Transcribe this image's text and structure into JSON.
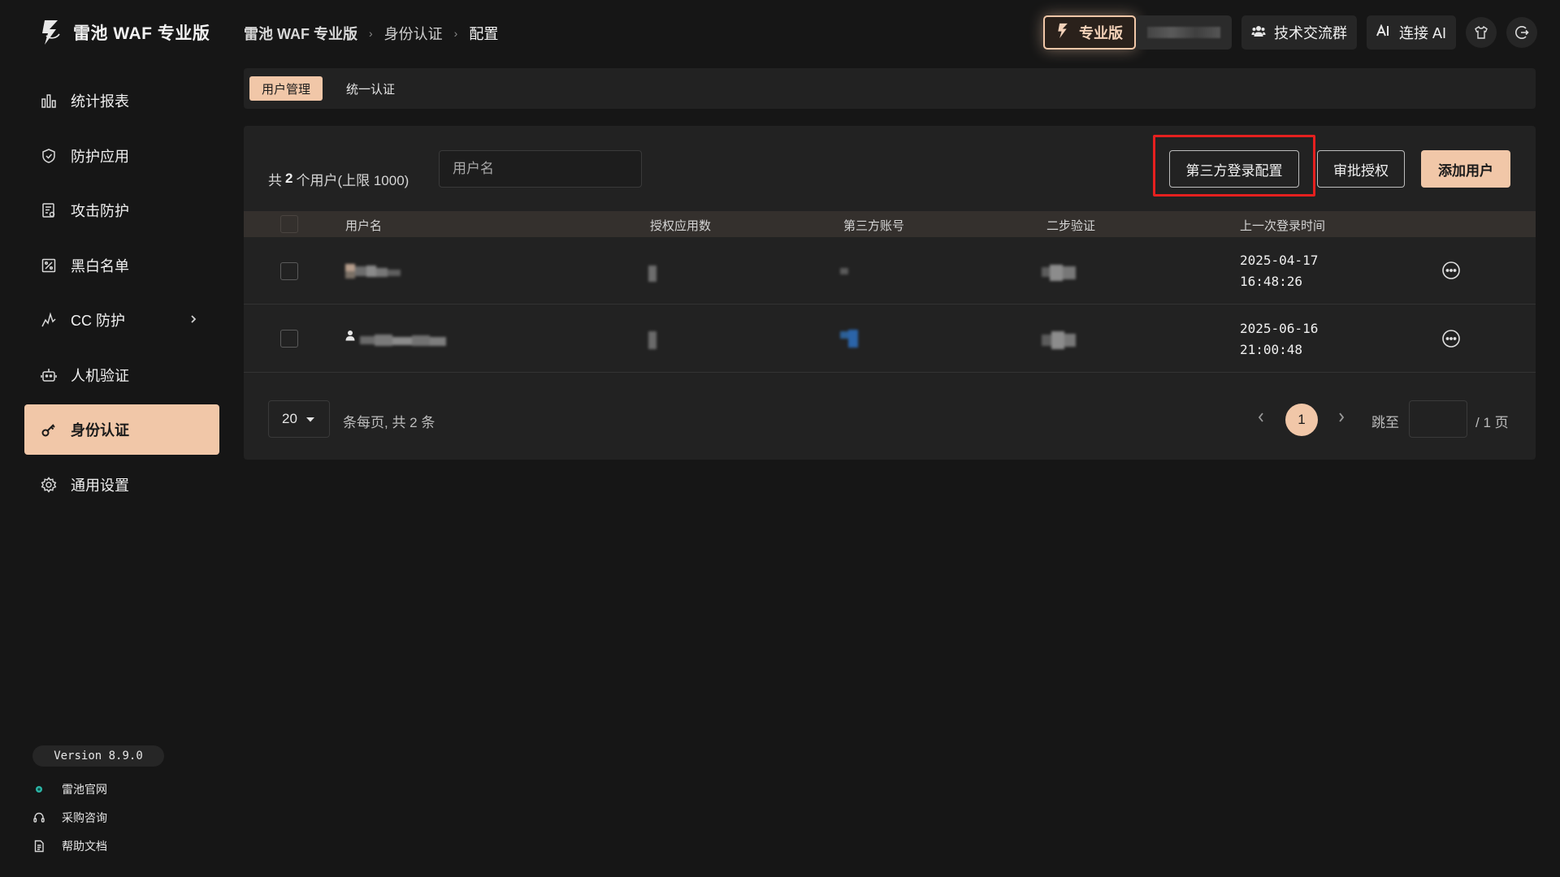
{
  "app": {
    "name": "雷池 WAF 专业版"
  },
  "breadcrumb": [
    "雷池 WAF 专业版",
    "身份认证",
    "配置"
  ],
  "header": {
    "pro_label": "专业版",
    "community_label": "技术交流群",
    "ai_label": "连接 AI"
  },
  "sidebar": {
    "items": [
      {
        "label": "统计报表",
        "icon": "bar-chart-icon"
      },
      {
        "label": "防护应用",
        "icon": "shield-icon"
      },
      {
        "label": "攻击防护",
        "icon": "document-icon"
      },
      {
        "label": "黑白名单",
        "icon": "percent-list-icon"
      },
      {
        "label": "CC 防护",
        "icon": "pulse-icon"
      },
      {
        "label": "人机验证",
        "icon": "robot-icon"
      },
      {
        "label": "身份认证",
        "icon": "key-icon"
      },
      {
        "label": "通用设置",
        "icon": "gear-icon"
      }
    ],
    "active_index": 6,
    "version": "Version 8.9.0",
    "footer_links": [
      {
        "label": "雷池官网",
        "icon": "globe-icon"
      },
      {
        "label": "采购咨询",
        "icon": "headset-icon"
      },
      {
        "label": "帮助文档",
        "icon": "doc-icon"
      }
    ]
  },
  "tabs": [
    {
      "label": "用户管理",
      "active": true
    },
    {
      "label": "统一认证",
      "active": false
    }
  ],
  "toolbar": {
    "total_prefix": "共",
    "total_count": "2",
    "total_suffix": "个用户(上限 1000)",
    "search_placeholder": "用户名",
    "third_party_button": "第三方登录配置",
    "approve_button": "审批授权",
    "add_button": "添加用户"
  },
  "table": {
    "columns": [
      "用户名",
      "授权应用数",
      "第三方账号",
      "二步验证",
      "上一次登录时间"
    ],
    "rows": [
      {
        "login_date": "2025-04-17",
        "login_time": "16:48:26"
      },
      {
        "login_date": "2025-06-16",
        "login_time": "21:00:48"
      }
    ]
  },
  "pagination": {
    "page_size": "20",
    "per_page_text": "条每页, 共 2 条",
    "current_page": "1",
    "jump_label": "跳至",
    "total_pages_text": "/ 1 页"
  },
  "colors": {
    "accent": "#f1c7a8",
    "background": "#161616",
    "panel": "#222222",
    "highlight": "#e5201f"
  }
}
